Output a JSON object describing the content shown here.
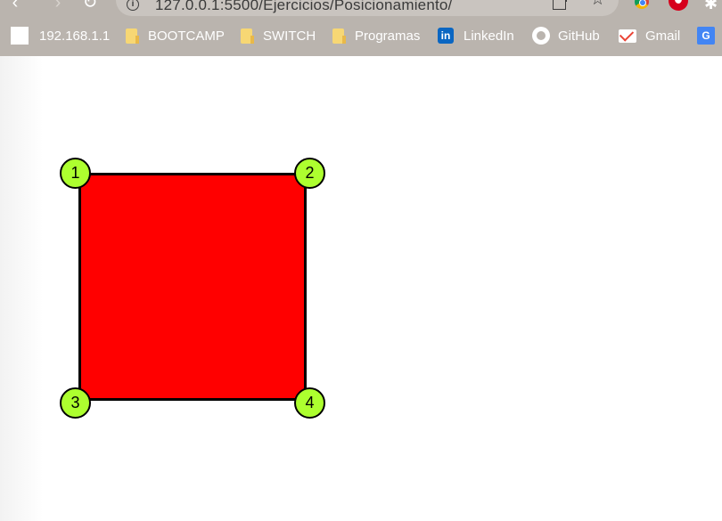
{
  "browser": {
    "url": "127.0.0.1:5500/Ejercicios/Posicionamiento/",
    "icons": {
      "back": "arrow-left-icon",
      "forward": "arrow-right-icon",
      "reload": "reload-icon",
      "info": "info-icon",
      "share": "share-icon",
      "bookmark": "star-icon"
    },
    "bookmarks": [
      {
        "label": "192.168.1.1",
        "icon": "page-icon"
      },
      {
        "label": "BOOTCAMP",
        "icon": "folder-icon"
      },
      {
        "label": "SWITCH",
        "icon": "folder-icon"
      },
      {
        "label": "Programas",
        "icon": "folder-icon"
      },
      {
        "label": "LinkedIn",
        "icon": "linkedin-icon"
      },
      {
        "label": "GitHub",
        "icon": "github-icon"
      },
      {
        "label": "Gmail",
        "icon": "gmail-icon"
      }
    ],
    "colors": {
      "chrome": "#bab4ae",
      "omnibox": "#c9c4bf"
    }
  },
  "page": {
    "box": {
      "color": "#ff0000",
      "border": "#000000"
    },
    "corners": [
      {
        "label": "1"
      },
      {
        "label": "2"
      },
      {
        "label": "3"
      },
      {
        "label": "4"
      }
    ],
    "corner_color": "#adff2f"
  }
}
